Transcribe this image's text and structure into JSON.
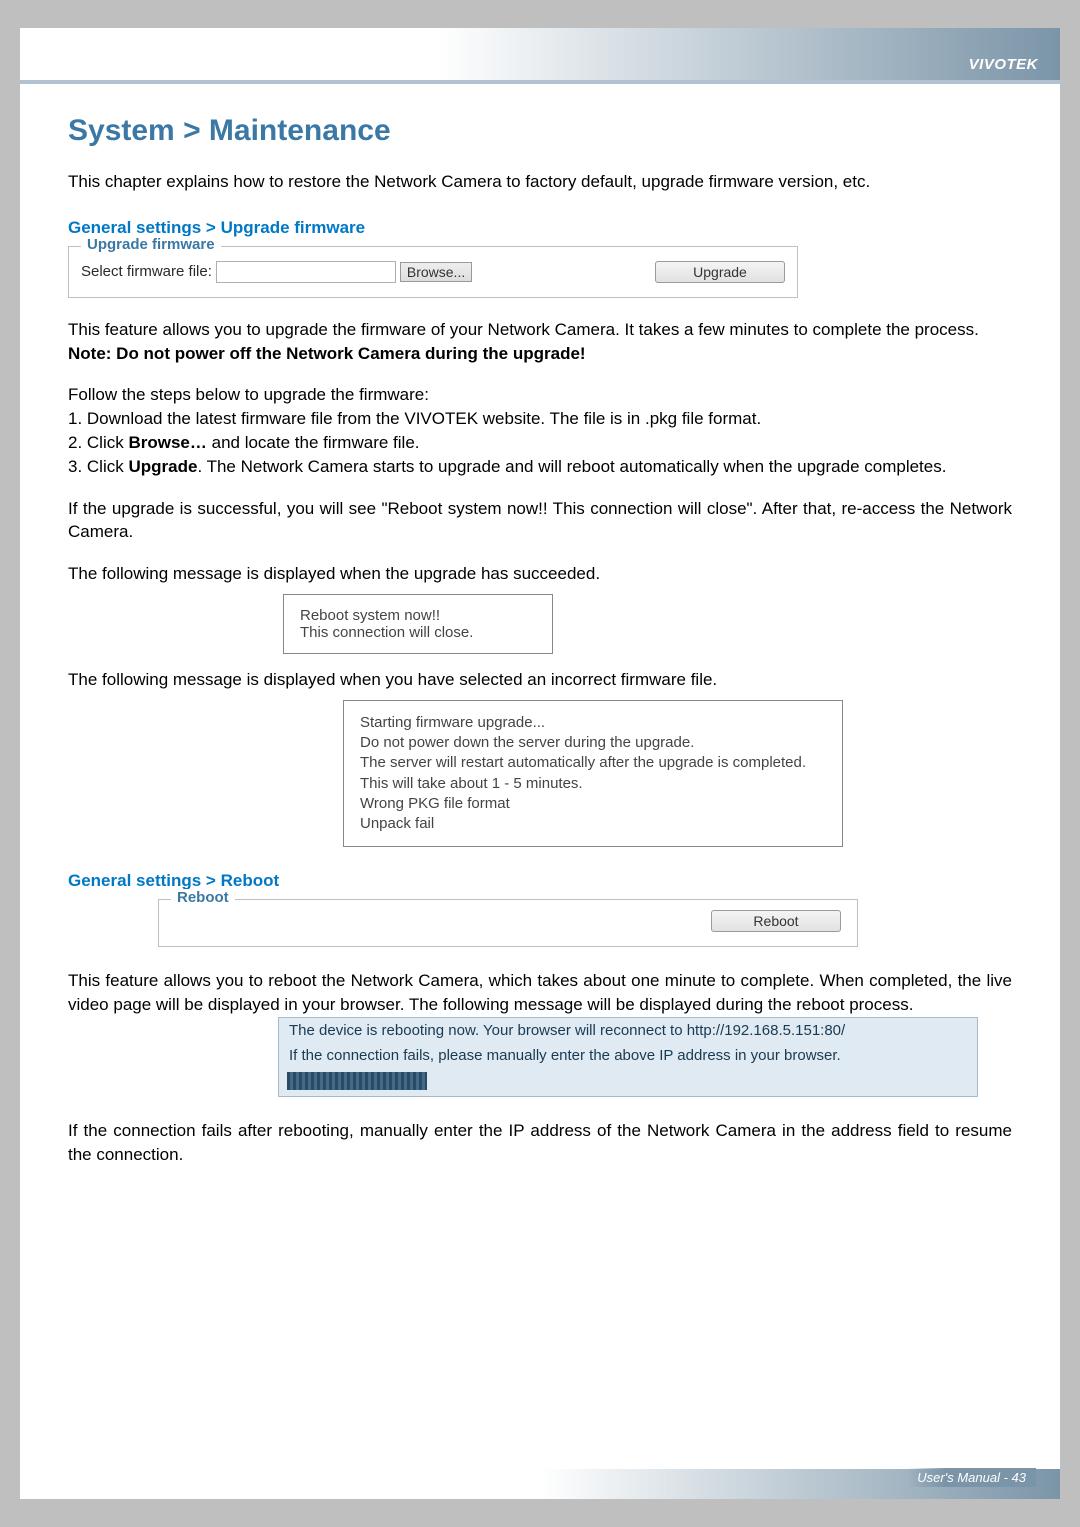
{
  "brand": "VIVOTEK",
  "page_title": "System > Maintenance",
  "intro": "This chapter explains how to restore the Network Camera to factory default, upgrade firmware version, etc.",
  "section_upgrade_heading": "General settings > Upgrade firmware",
  "fieldset_upgrade": {
    "legend": "Upgrade firmware",
    "file_label": "Select firmware file:",
    "browse_btn": "Browse...",
    "upgrade_btn": "Upgrade"
  },
  "upgrade_desc_1": "This feature allows you to upgrade the firmware of your Network Camera. It takes a few minutes to complete the process.",
  "upgrade_note": "Note: Do not power off the Network Camera during the upgrade!",
  "steps_intro": "Follow the steps below to upgrade the firmware:",
  "step1": "1. Download the latest firmware file from the VIVOTEK website. The file is in .pkg file format.",
  "step2_pre": "2. Click ",
  "step2_bold": "Browse…",
  "step2_post": " and locate the firmware file.",
  "step3_pre": "3. Click ",
  "step3_bold": "Upgrade",
  "step3_post": ". The Network Camera starts to upgrade and will reboot automatically when the upgrade completes.",
  "success_para": "If the upgrade is successful, you will see \"Reboot system now!! This connection will close\". After that, re-access the Network Camera.",
  "succeeded_intro": "The following message is displayed when the upgrade has succeeded.",
  "msg_success_l1": "Reboot system now!!",
  "msg_success_l2": "This connection will close.",
  "incorrect_intro": "The following message is displayed when you have selected an incorrect firmware file.",
  "msg_fail_l1": "Starting firmware upgrade...",
  "msg_fail_l2": "Do not power down the server during the upgrade.",
  "msg_fail_l3": "The server will restart automatically after the upgrade is completed.",
  "msg_fail_l4": "This will take about 1 - 5 minutes.",
  "msg_fail_l5": "Wrong PKG file format",
  "msg_fail_l6": "Unpack fail",
  "section_reboot_heading": "General settings > Reboot",
  "fieldset_reboot": {
    "legend": "Reboot",
    "reboot_btn": "Reboot"
  },
  "reboot_desc": "This feature allows you to reboot the Network Camera, which takes about one minute to complete. When completed, the live video page will be displayed in your browser. The following message will be displayed during the reboot process.",
  "reboot_panel_l1": "The device is rebooting now. Your browser will reconnect to http://192.168.5.151:80/",
  "reboot_panel_l2": "If the connection fails, please manually enter the above IP address in your browser.",
  "reboot_after": "If the connection fails after rebooting, manually enter the IP address of the Network Camera in the address field to resume the connection.",
  "footer": "User's Manual - 43"
}
